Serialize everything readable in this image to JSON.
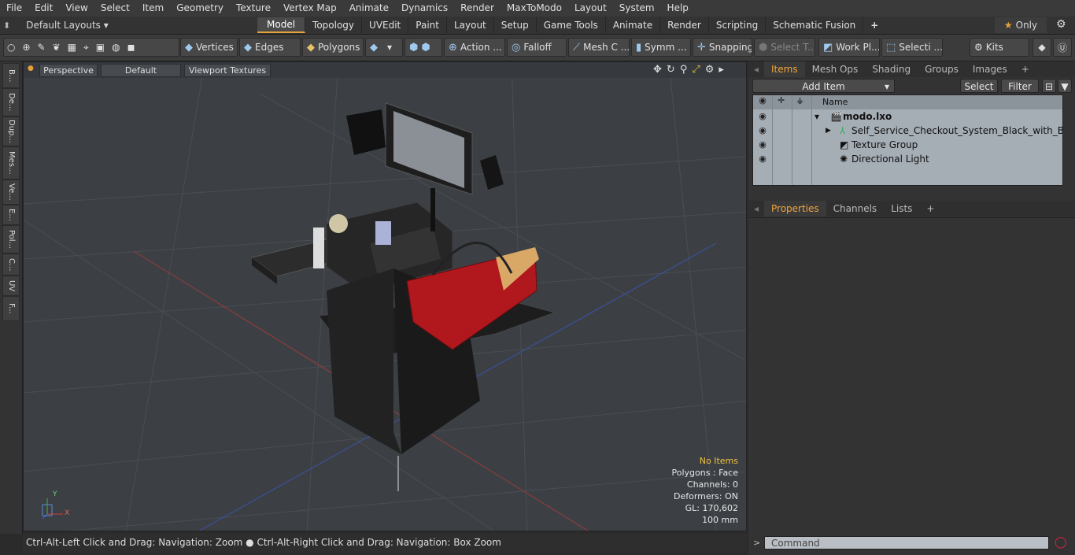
{
  "menu": [
    "File",
    "Edit",
    "View",
    "Select",
    "Item",
    "Geometry",
    "Texture",
    "Vertex Map",
    "Animate",
    "Dynamics",
    "Render",
    "MaxToModo",
    "Layout",
    "System",
    "Help"
  ],
  "layoutbar": {
    "layout_label": "Default Layouts ▾",
    "tabs": [
      "Model",
      "Topology",
      "UVEdit",
      "Paint",
      "Layout",
      "Setup",
      "Game Tools",
      "Animate",
      "Render",
      "Scripting",
      "Schematic Fusion"
    ],
    "active_tab": "Model",
    "add": "+",
    "only_label": "Only"
  },
  "toolbar": {
    "vertices": "Vertices",
    "edges": "Edges",
    "polygons": "Polygons",
    "action": "Action ...",
    "falloff": "Falloff",
    "mesh": "Mesh C ...",
    "symm": "Symm ...",
    "snapping": "Snapping",
    "select_t": "Select T...",
    "workpl": "Work Pl...",
    "selecti": "Selecti ...",
    "kits": "Kits"
  },
  "leftstrip": [
    "B...",
    "De...",
    "Dup...",
    "Mes...",
    "Ve...",
    "E...",
    "Pol...",
    "C...",
    "UV",
    "F..."
  ],
  "viewport": {
    "perspective": "Perspective",
    "default": "Default",
    "textures": "Viewport Textures",
    "stats": {
      "no_items": "No Items",
      "polygons": "Polygons : Face",
      "channels": "Channels: 0",
      "deformers": "Deformers: ON",
      "gl": "GL: 170,602",
      "unit": "100 mm"
    },
    "axis": {
      "x": "X",
      "y": "Y",
      "z": "Z"
    }
  },
  "status": "Ctrl-Alt-Left Click and Drag: Navigation: Zoom ● Ctrl-Alt-Right Click and Drag: Navigation: Box Zoom",
  "panel": {
    "tabs": [
      "Items",
      "Mesh Ops",
      "Shading",
      "Groups",
      "Images"
    ],
    "add_item": "Add Item",
    "select": "Select",
    "filter": "Filter",
    "name_col": "Name",
    "items": [
      {
        "label": "modo.lxo",
        "bold": true
      },
      {
        "label": "Self_Service_Checkout_System_Black_with_Basket_..."
      },
      {
        "label": "Texture Group"
      },
      {
        "label": "Directional Light"
      }
    ],
    "prop_tabs": [
      "Properties",
      "Channels",
      "Lists"
    ],
    "command_placeholder": "Command"
  },
  "colors": {
    "accent": "#e6a13a",
    "viewport_bg": "#3c4045",
    "list_bg": "#a5adb5"
  }
}
